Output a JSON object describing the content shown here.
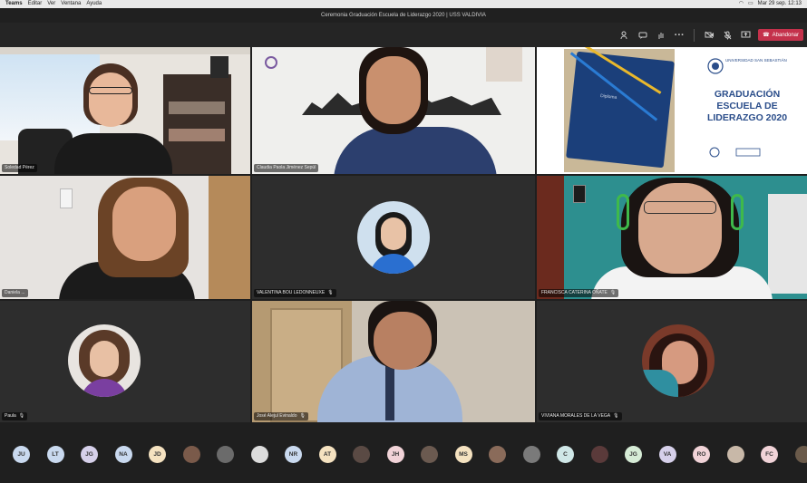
{
  "menubar": {
    "app": "Teams",
    "items": [
      "Editar",
      "Ver",
      "Ventana",
      "Ayuda"
    ],
    "clock": "Mar 29 sep. 12:13"
  },
  "window": {
    "title": "Ceremonia Graduación Escuela de Liderazgo 2020 | USS VALDIVIA"
  },
  "toolbar": {
    "leave_label": "Abandonar",
    "accent": "#c4314b"
  },
  "participants": [
    {
      "name": "Soledad Pérez",
      "mic": ""
    },
    {
      "name": "Claudia Paola Jiménez Sepúl",
      "mic": ""
    },
    {
      "name": "",
      "mic": ""
    },
    {
      "name": "Daniela ...",
      "mic": ""
    },
    {
      "name": "VALENTINA BOU LEDONNEUXE",
      "mic": "🎙"
    },
    {
      "name": "FRANCISCA CATERINA OÑATE",
      "mic": "🎙"
    },
    {
      "name": "Paula",
      "mic": "🎙"
    },
    {
      "name": "José Alejul Evinaldo",
      "mic": "🎙"
    },
    {
      "name": "VIVIANA MORALES DE LA VEGA",
      "mic": "🎙"
    }
  ],
  "slide": {
    "university": "UNIVERSIDAD SAN SEBASTIÁN",
    "title_line1": "GRADUACIÓN",
    "title_line2": "ESCUELA DE",
    "title_line3": "LIDERAZGO 2020",
    "diploma_label": "Diploma"
  },
  "attendees": [
    {
      "initials": "JU",
      "color": "#c9d9ef"
    },
    {
      "initials": "LT",
      "color": "#c9d9ef"
    },
    {
      "initials": "JG",
      "color": "#d6d0ea"
    },
    {
      "initials": "NA",
      "color": "#c9d9ef"
    },
    {
      "initials": "JD",
      "color": "#f5e2c0"
    },
    {
      "initials": "",
      "color": "#7a5a4a"
    },
    {
      "initials": "",
      "color": "#6b6b6b"
    },
    {
      "initials": "",
      "color": "#dcdcdc"
    },
    {
      "initials": "NR",
      "color": "#c9d9ef"
    },
    {
      "initials": "AT",
      "color": "#f5e2c0"
    },
    {
      "initials": "",
      "color": "#5a4a44"
    },
    {
      "initials": "JH",
      "color": "#f1d3d8"
    },
    {
      "initials": "",
      "color": "#6b5a50"
    },
    {
      "initials": "MS",
      "color": "#f5e2c0"
    },
    {
      "initials": "",
      "color": "#8a6b5a"
    },
    {
      "initials": "",
      "color": "#7a7a7a"
    },
    {
      "initials": "C",
      "color": "#cfe7e7"
    },
    {
      "initials": "",
      "color": "#5a3a3a"
    },
    {
      "initials": "JG",
      "color": "#d6ecd6"
    },
    {
      "initials": "VA",
      "color": "#d6d0ea"
    },
    {
      "initials": "RO",
      "color": "#f1d3d8"
    },
    {
      "initials": "",
      "color": "#c8b8a8"
    },
    {
      "initials": "FC",
      "color": "#f1d3d8"
    },
    {
      "initials": "",
      "color": "#6a5a4a"
    }
  ]
}
